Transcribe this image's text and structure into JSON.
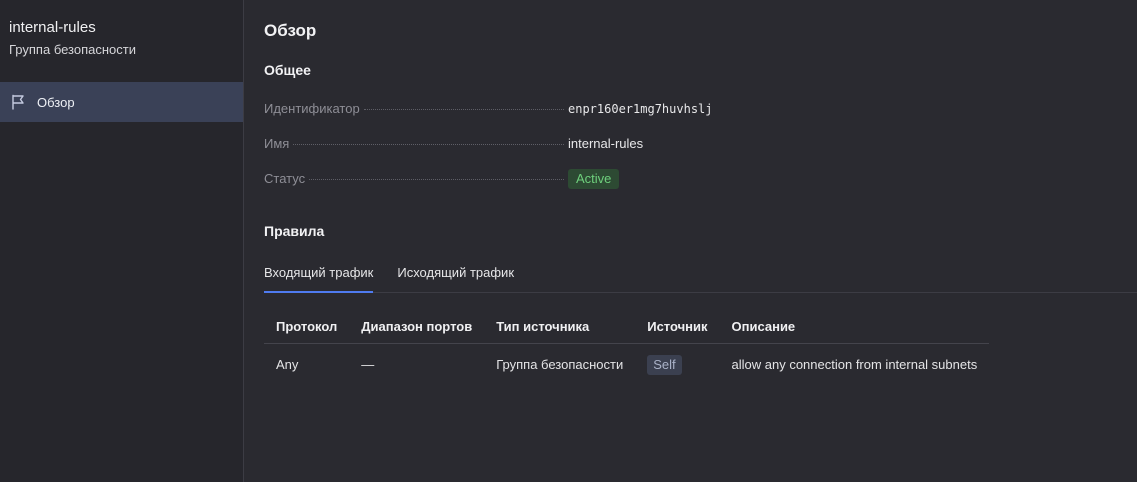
{
  "sidebar": {
    "title": "internal-rules",
    "subtitle": "Группа безопасности",
    "items": [
      {
        "label": "Обзор",
        "icon": "flag-icon",
        "active": true
      }
    ]
  },
  "main": {
    "page_title": "Обзор",
    "general": {
      "title": "Общее",
      "id_label": "Идентификатор",
      "id_value": "enpr160er1mg7huvhslj",
      "name_label": "Имя",
      "name_value": "internal-rules",
      "status_label": "Статус",
      "status_value": "Active"
    },
    "rules": {
      "title": "Правила",
      "tabs": [
        {
          "label": "Входящий трафик",
          "active": true
        },
        {
          "label": "Исходящий трафик",
          "active": false
        }
      ],
      "columns": [
        "Протокол",
        "Диапазон портов",
        "Тип источника",
        "Источник",
        "Описание"
      ],
      "rows": [
        {
          "protocol": "Any",
          "ports": "—",
          "source_type": "Группа безопасности",
          "source": "Self",
          "description": "allow any connection from internal subnets"
        }
      ]
    }
  },
  "colors": {
    "accent": "#4f7bf0",
    "active_status_bg": "#2d4a33",
    "active_status_text": "#6ecf7c",
    "sidebar_active_bg": "#3a4157"
  }
}
